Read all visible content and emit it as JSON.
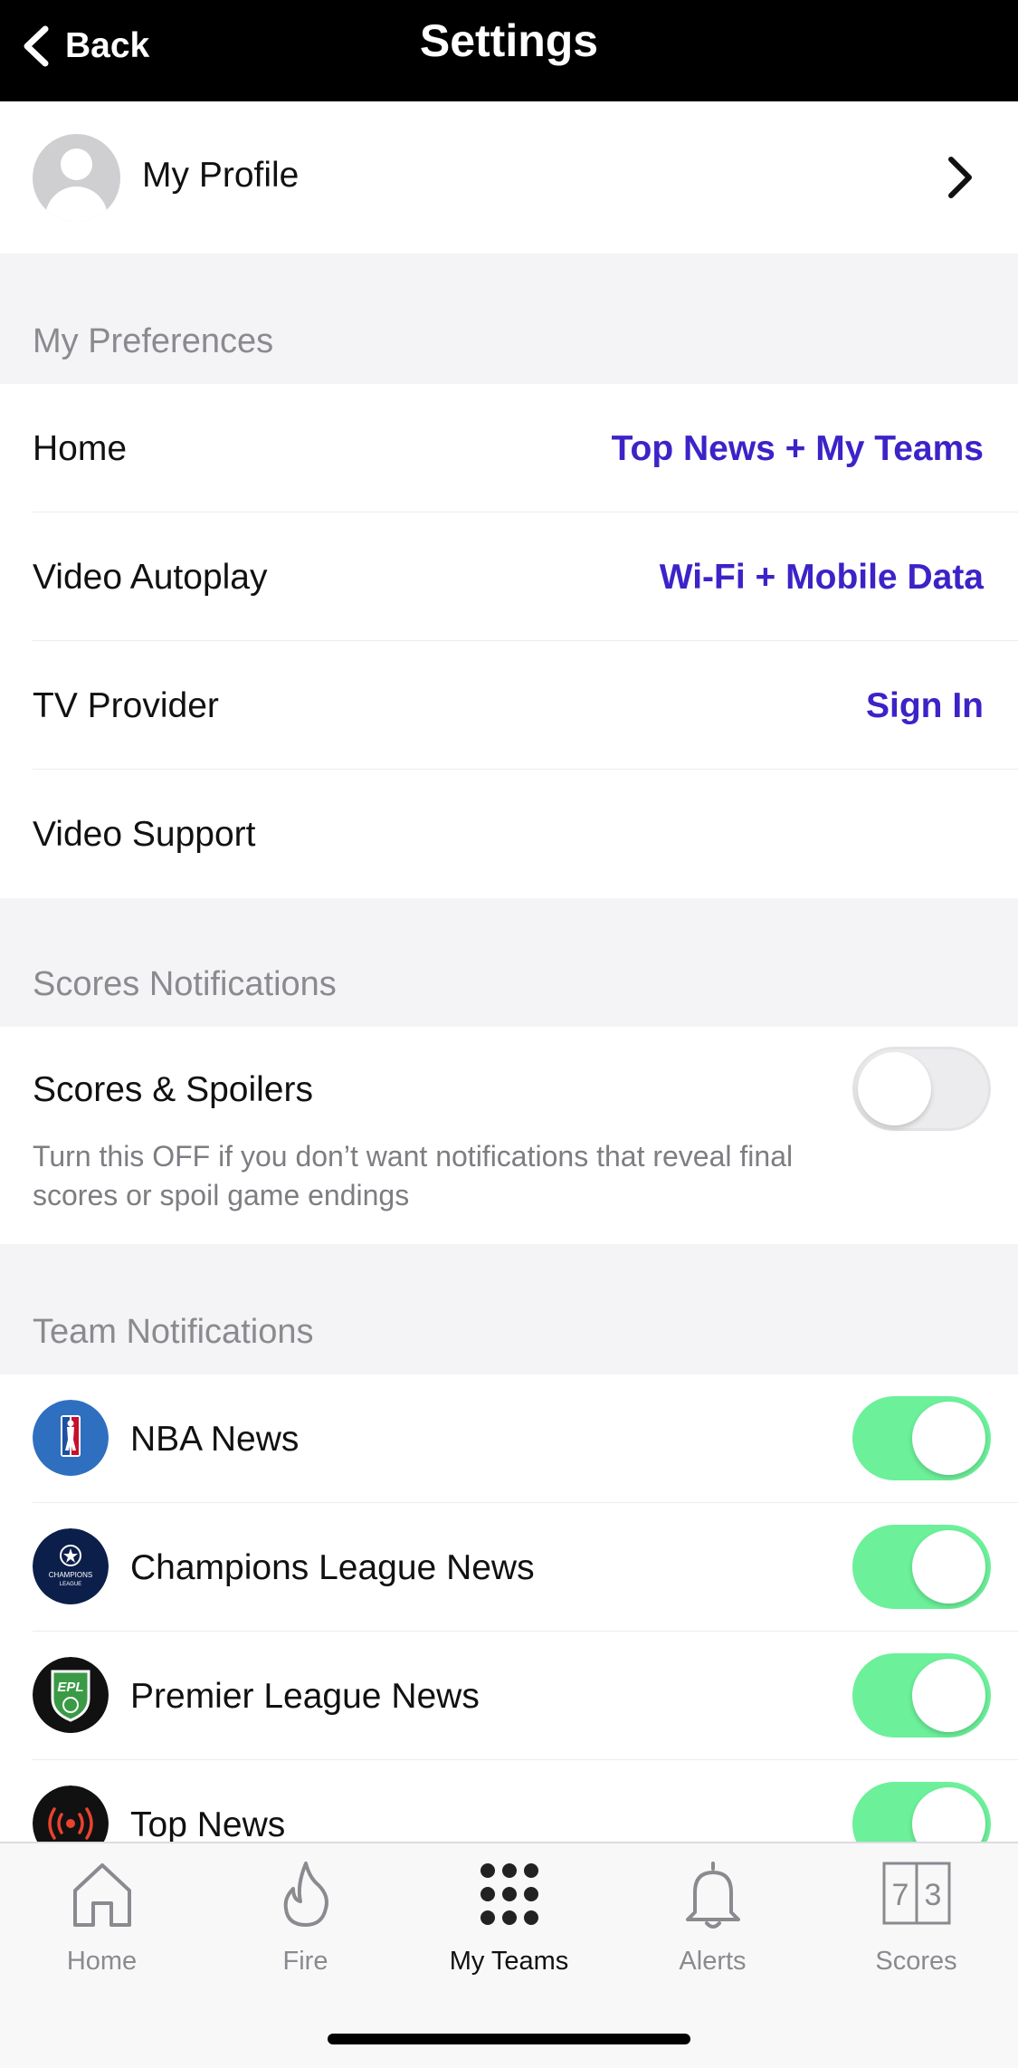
{
  "navbar": {
    "back_label": "Back",
    "title": "Settings"
  },
  "profile": {
    "label": "My Profile"
  },
  "preferences": {
    "header": "My Preferences",
    "rows": [
      {
        "label": "Home",
        "value": "Top News + My Teams"
      },
      {
        "label": "Video Autoplay",
        "value": "Wi-Fi + Mobile Data"
      },
      {
        "label": "TV Provider",
        "value": "Sign In"
      },
      {
        "label": "Video Support",
        "value": ""
      }
    ]
  },
  "scores_notifications": {
    "header": "Scores Notifications",
    "spoilers_label": "Scores & Spoilers",
    "spoilers_desc": "Turn this OFF if you don’t want notifications that reveal final scores or spoil game endings",
    "spoilers_on": false
  },
  "team_notifications": {
    "header": "Team Notifications",
    "teams": [
      {
        "label": "NBA News",
        "icon": "nba-logo-icon",
        "on": true
      },
      {
        "label": "Champions League News",
        "icon": "champions-league-logo-icon",
        "on": true
      },
      {
        "label": "Premier League News",
        "icon": "premier-league-logo-icon",
        "on": true
      },
      {
        "label": "Top News",
        "icon": "broadcast-icon",
        "on": true
      }
    ]
  },
  "tabbar": {
    "tabs": [
      {
        "label": "Home",
        "icon": "house-icon",
        "active": false
      },
      {
        "label": "Fire",
        "icon": "flame-icon",
        "active": false
      },
      {
        "label": "My Teams",
        "icon": "grid-dots-icon",
        "active": true
      },
      {
        "label": "Alerts",
        "icon": "bell-icon",
        "active": false
      },
      {
        "label": "Scores",
        "icon": "scoreboard-icon",
        "active": false
      }
    ],
    "scoreboard_digits": [
      "7",
      "3"
    ]
  },
  "colors": {
    "accent": "#3b23c8",
    "toggle_on": "#6cf09a",
    "navbar_bg": "#000000",
    "section_bg": "#f4f4f6"
  }
}
